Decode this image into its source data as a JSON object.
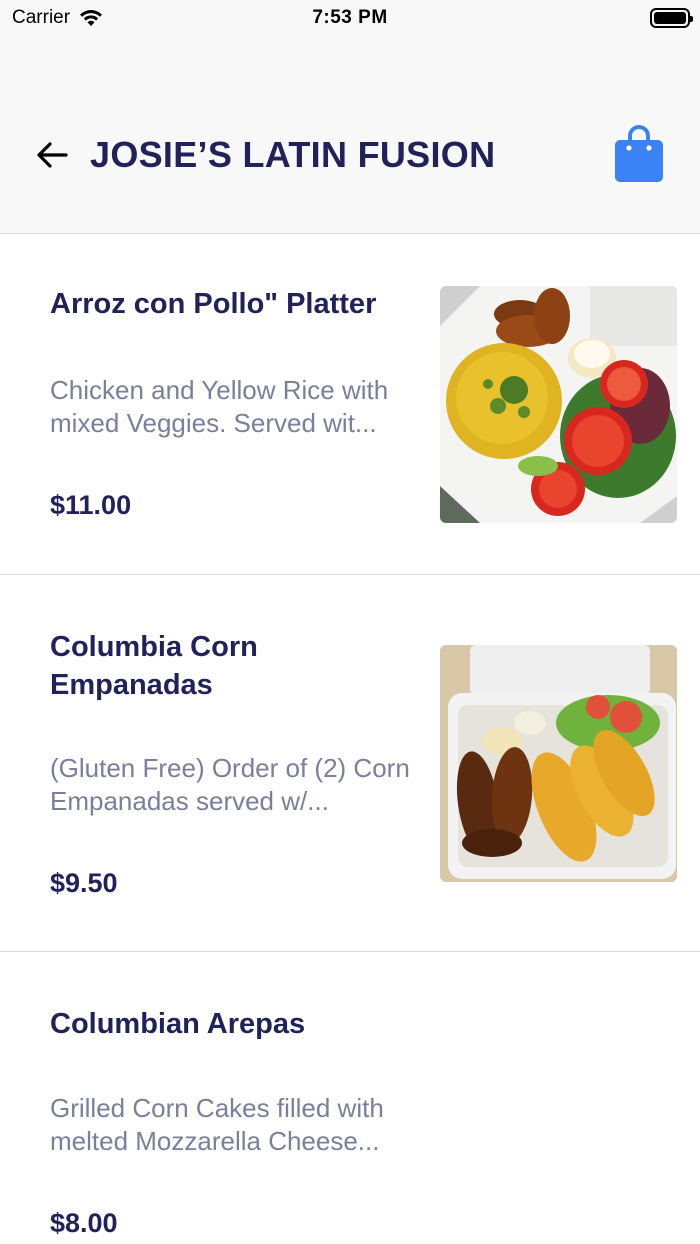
{
  "status_bar": {
    "carrier": "Carrier",
    "time": "7:53 PM"
  },
  "header": {
    "title": "JOSIE’S LATIN FUSION",
    "back_icon": "arrow-left-icon",
    "cart_icon": "shopping-bag-icon",
    "accent_color": "#3b82f6"
  },
  "menu": {
    "items": [
      {
        "name": "Arroz con Pollo\" Platter",
        "description": "Chicken and Yellow Rice with mixed Veggies.  Served wit...",
        "price": "$11.00",
        "image": "arroz-con-pollo-photo"
      },
      {
        "name": "Columbia Corn Empanadas",
        "description": "(Gluten Free) Order of (2) Corn Empanadas served w/...",
        "price": "$9.50",
        "image": "corn-empanadas-photo"
      },
      {
        "name": "Columbian Arepas",
        "description": "Grilled Corn Cakes filled with melted Mozzarella Cheese...",
        "price": "$8.00",
        "image": ""
      }
    ]
  }
}
